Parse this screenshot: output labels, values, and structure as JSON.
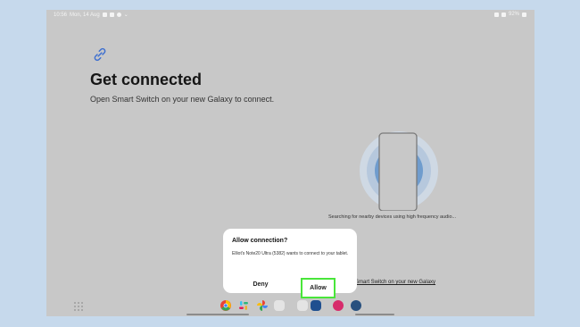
{
  "status_bar": {
    "time": "10:56",
    "date": "Mon, 14 Aug",
    "battery": "92%"
  },
  "main": {
    "title": "Get connected",
    "subtitle": "Open Smart Switch on your new Galaxy to connect.",
    "searching_text": "Searching for nearby devices using high frequency audio...",
    "link_text": "Smart Switch on your new Galaxy"
  },
  "dialog": {
    "title": "Allow connection?",
    "message": "Elliot's Note20 Ultra (5382) wants to connect to your tablet.",
    "deny_label": "Deny",
    "allow_label": "Allow"
  },
  "taskbar": {
    "apps": [
      "chrome-icon",
      "slack-icon",
      "photos-icon",
      "apps-folder-icon",
      "app-folder-icon",
      "news-app-icon",
      "flower-app-icon",
      "settings-icon"
    ]
  },
  "colors": {
    "background": "#c6d9ec",
    "screen": "#c8c8c8",
    "accent_blue": "#3d6fd0",
    "highlight_green": "#49e63a"
  }
}
